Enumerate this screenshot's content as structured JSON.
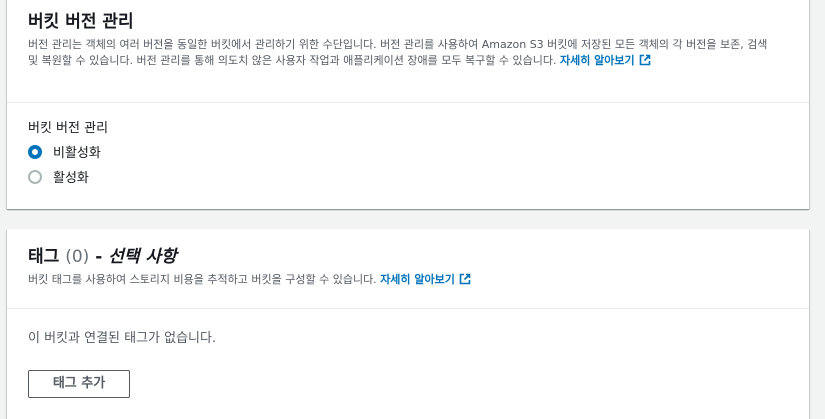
{
  "versioning": {
    "title": "버킷 버전 관리",
    "description": "버전 관리는 객체의 여러 버전을 동일한 버킷에서 관리하기 위한 수단입니다. 버전 관리를 사용하여 Amazon S3 버킷에 저장된 모든 객체의 각 버전을 보존, 검색 및 복원할 수 있습니다. 버전 관리를 통해 의도치 않은 사용자 작업과 애플리케이션 장애를 모두 복구할 수 있습니다.",
    "learn_more": "자세히 알아보기",
    "field_label": "버킷 버전 관리",
    "options": [
      {
        "label": "비활성화",
        "selected": true
      },
      {
        "label": "활성화",
        "selected": false
      }
    ]
  },
  "tags": {
    "title": "태그",
    "count": "(0)",
    "separator": " - ",
    "optional": "선택 사항",
    "description": "버킷 태그를 사용하여 스토리지 비용을 추적하고 버킷을 구성할 수 있습니다.",
    "learn_more": "자세히 알아보기",
    "empty_text": "이 버킷과 연결된 태그가 없습니다.",
    "add_button": "태그 추가"
  },
  "colors": {
    "link": "#0073bb",
    "radio_selected": "#0073bb",
    "background": "#f2f3f3"
  },
  "icons": {
    "external_link": "external-link-icon"
  }
}
